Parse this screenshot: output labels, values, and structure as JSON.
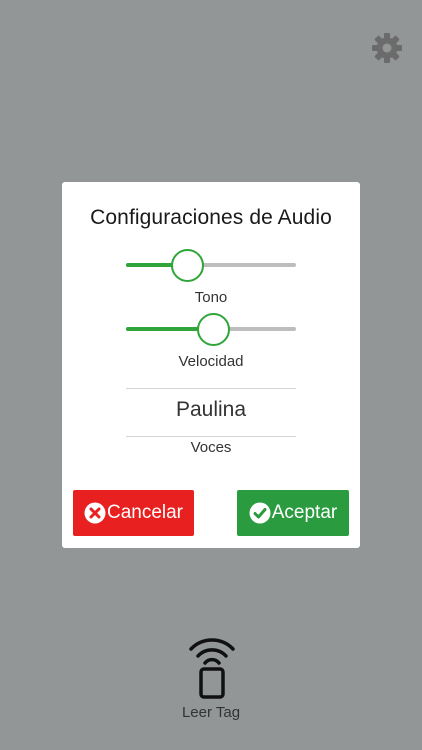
{
  "header": {
    "settings_icon": "gear-icon"
  },
  "audio_dialog": {
    "title": "Configuraciones de Audio",
    "tone": {
      "label": "Tono",
      "value": 0.36
    },
    "speed": {
      "label": "Velocidad",
      "value": 0.51
    },
    "voice": {
      "selected": "Paulina",
      "label": "Voces"
    },
    "cancel_button": {
      "label": "Cancelar",
      "icon": "x-circle-icon",
      "color": "#e8201f"
    },
    "accept_button": {
      "label": "Aceptar",
      "icon": "check-circle-icon",
      "color": "#2a9b3e"
    }
  },
  "footer": {
    "read_tag_icon": "nfc-phone-icon",
    "read_tag_label": "Leer Tag"
  },
  "colors": {
    "background": "#929696",
    "slider_active": "#2fa53a",
    "slider_inactive": "#bdbdbd"
  }
}
